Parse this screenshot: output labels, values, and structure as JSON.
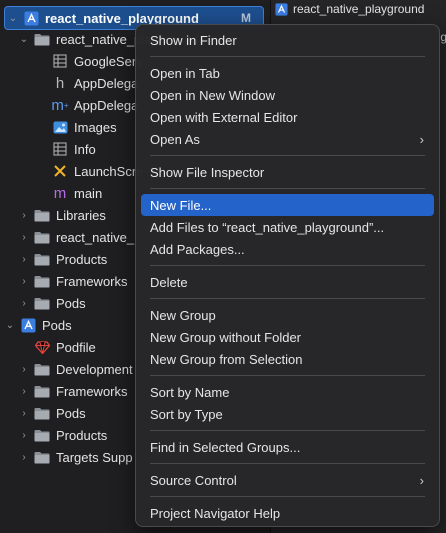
{
  "colors": {
    "accent": "#2463c9",
    "root_selection": "#1d4f8f",
    "menu_bg": "#28282a"
  },
  "navigator": {
    "root": {
      "label": "react_native_playground",
      "badge": "M",
      "icon": "xcode-project-icon"
    },
    "items": [
      {
        "label": "react_native_playground",
        "icon": "folder-icon",
        "expanded": true
      },
      {
        "label": "GoogleServ",
        "icon": "plist-table-icon"
      },
      {
        "label": "AppDelega",
        "icon": "header-h-icon"
      },
      {
        "label": "AppDelega",
        "icon": "objc-m-icon"
      },
      {
        "label": "Images",
        "icon": "asset-catalog-icon"
      },
      {
        "label": "Info",
        "icon": "plist-table-icon"
      },
      {
        "label": "LaunchScre",
        "icon": "storyboard-x-icon"
      },
      {
        "label": "main",
        "icon": "objc-m-purple-icon"
      },
      {
        "label": "Libraries",
        "icon": "folder-icon"
      },
      {
        "label": "react_native_",
        "icon": "folder-icon"
      },
      {
        "label": "Products",
        "icon": "folder-icon"
      },
      {
        "label": "Frameworks",
        "icon": "folder-icon"
      },
      {
        "label": "Pods",
        "icon": "folder-icon"
      },
      {
        "label": "Pods",
        "icon": "xcode-project-icon"
      },
      {
        "label": "Podfile",
        "icon": "ruby-gem-icon"
      },
      {
        "label": "Development",
        "icon": "folder-icon"
      },
      {
        "label": "Frameworks",
        "icon": "folder-icon"
      },
      {
        "label": "Pods",
        "icon": "folder-icon"
      },
      {
        "label": "Products",
        "icon": "folder-icon"
      },
      {
        "label": "Targets Supp",
        "icon": "folder-icon"
      }
    ]
  },
  "editor": {
    "breadcrumb": "react_native_playground",
    "tail": "g"
  },
  "menu": {
    "show_in_finder": "Show in Finder",
    "open_in_tab": "Open in Tab",
    "open_in_new_window": "Open in New Window",
    "open_with_external_editor": "Open with External Editor",
    "open_as": "Open As",
    "show_file_inspector": "Show File Inspector",
    "new_file": "New File...",
    "add_files": "Add Files to “react_native_playground”...",
    "add_packages": "Add Packages...",
    "delete": "Delete",
    "new_group": "New Group",
    "new_group_without_folder": "New Group without Folder",
    "new_group_from_selection": "New Group from Selection",
    "sort_by_name": "Sort by Name",
    "sort_by_type": "Sort by Type",
    "find_in_selected_groups": "Find in Selected Groups...",
    "source_control": "Source Control",
    "project_navigator_help": "Project Navigator Help",
    "submenu_glyph": "›"
  }
}
